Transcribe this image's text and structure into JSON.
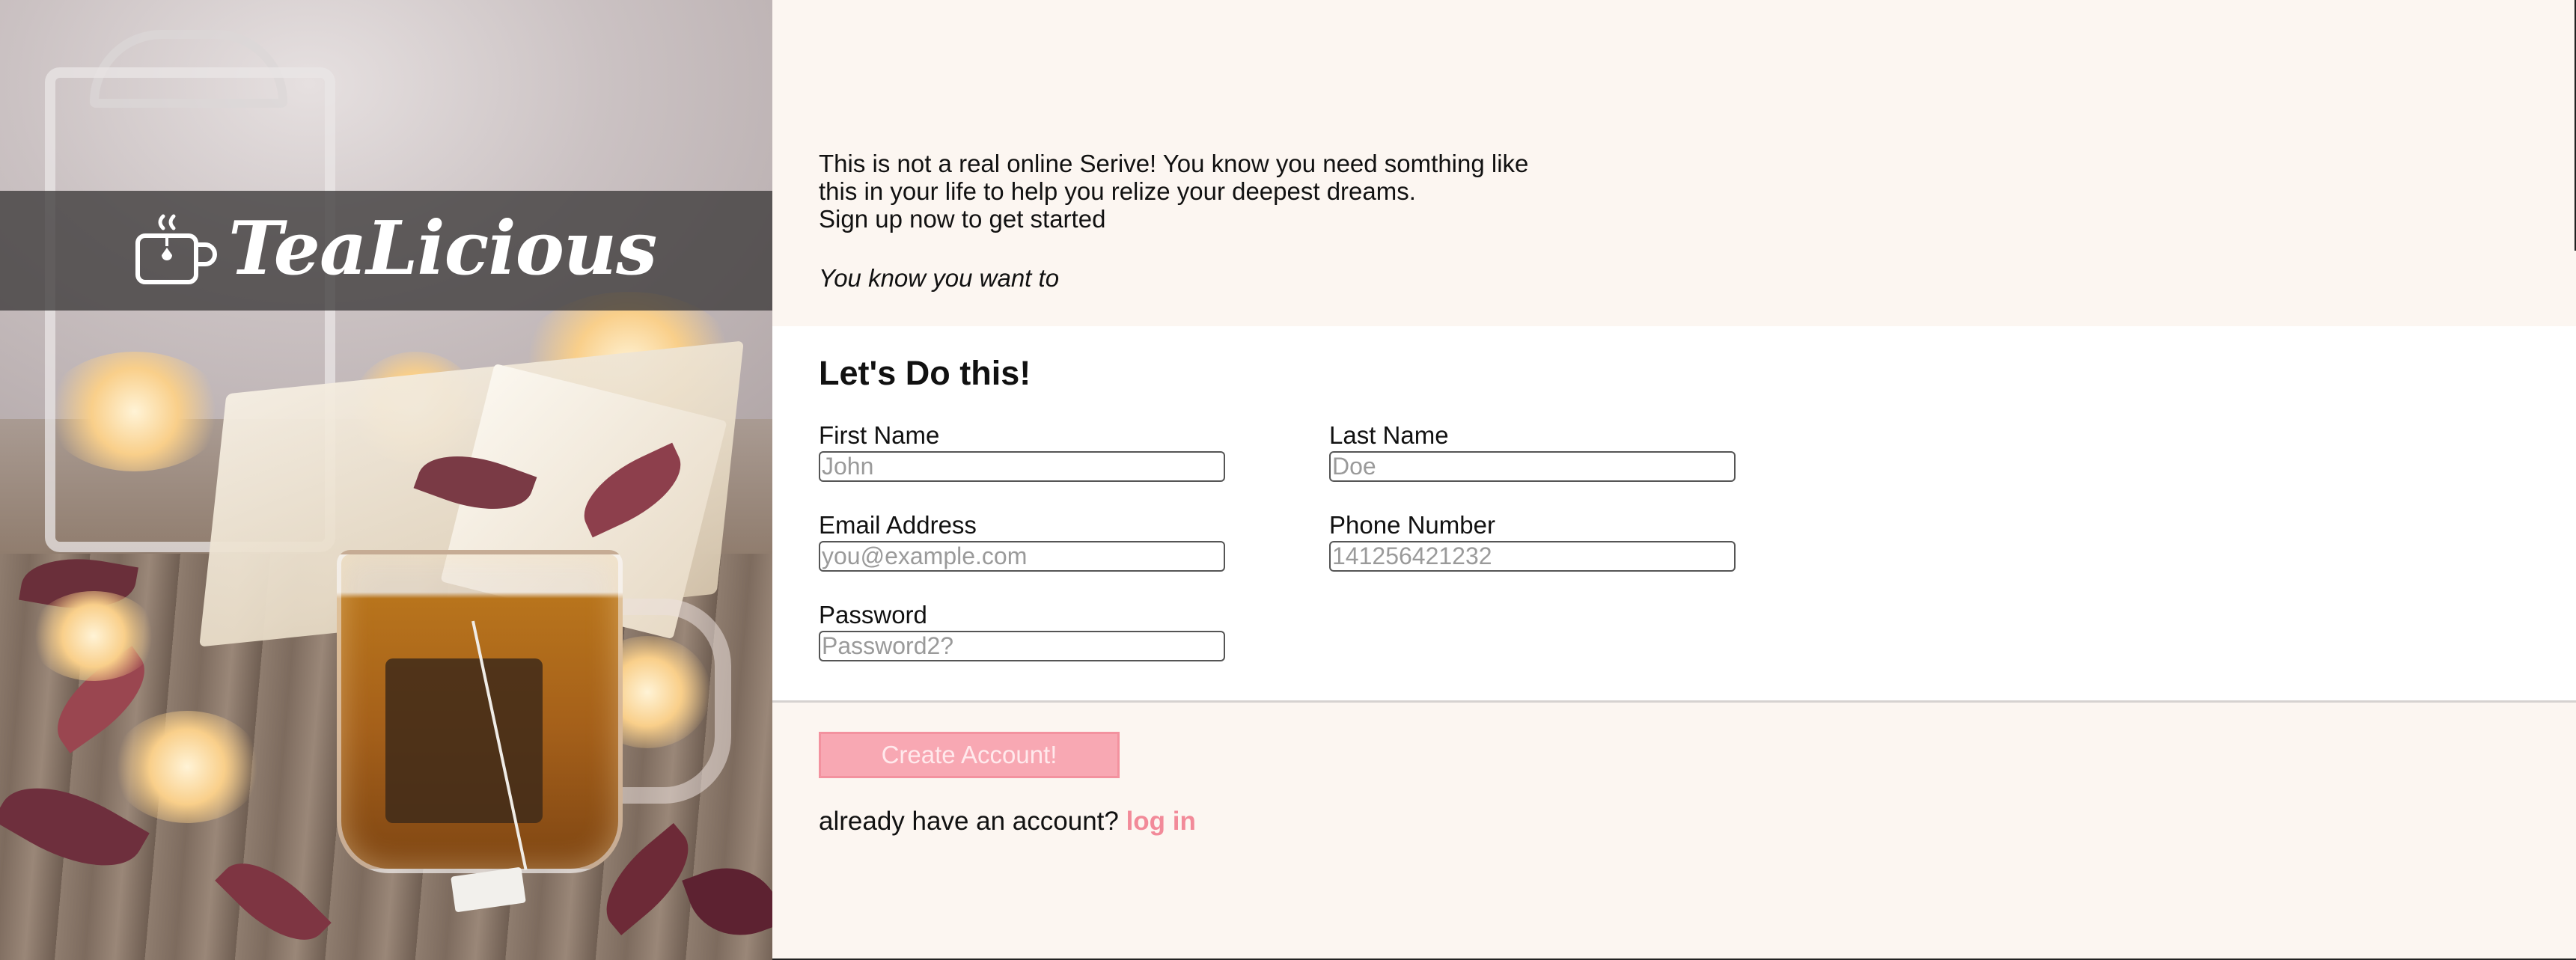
{
  "brand": {
    "name": "TeaLicious",
    "icon": "teacup-icon"
  },
  "intro": {
    "line1": "This is not a real online Serive! You know you need somthing like",
    "line2": "this in your life to help you relize your deepest dreams.",
    "line3": "Sign up now to get started",
    "tagline": "You know you want to"
  },
  "form": {
    "title": "Let's Do this!",
    "first_name": {
      "label": "First Name",
      "placeholder": "John",
      "value": ""
    },
    "last_name": {
      "label": "Last Name",
      "placeholder": "Doe",
      "value": ""
    },
    "email": {
      "label": "Email Address",
      "placeholder": "you@example.com",
      "value": ""
    },
    "phone": {
      "label": "Phone Number",
      "placeholder": "14125642123‍2",
      "value": ""
    },
    "password": {
      "label": "Password",
      "placeholder": "Password2?",
      "value": ""
    }
  },
  "actions": {
    "create_label": "Create Account!",
    "login_prompt": "already have an account?",
    "login_link": "log in"
  },
  "colors": {
    "accent": "#f8a8b3",
    "link": "#f28a99",
    "panel_bg": "#fcf6f1",
    "form_bg": "#ffffff",
    "brand_band": "#3c3a3a"
  }
}
